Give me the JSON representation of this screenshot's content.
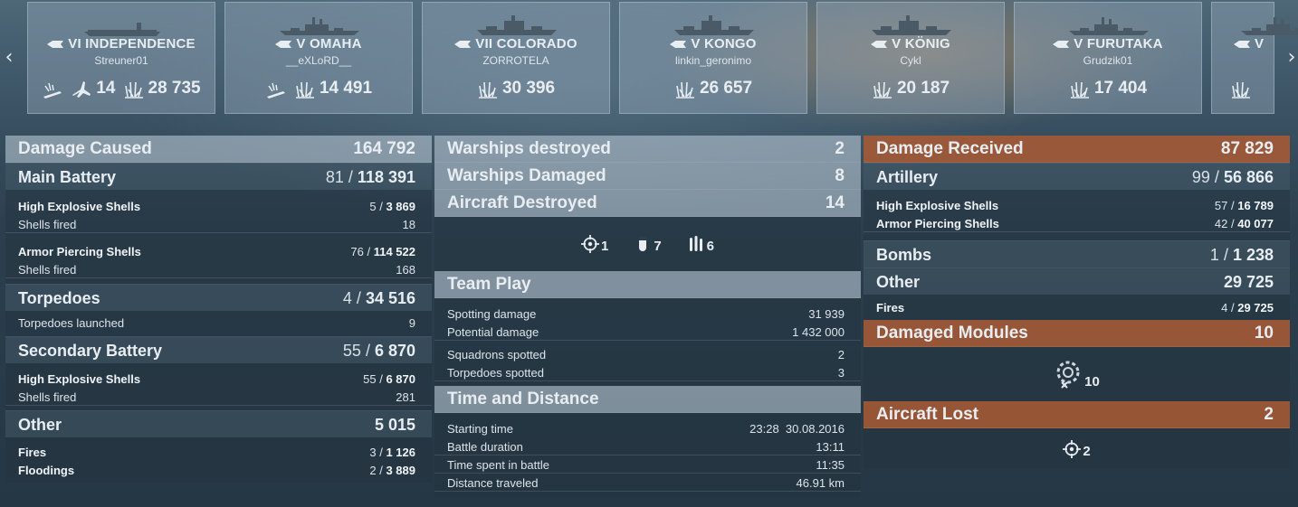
{
  "nav": {
    "prev": "‹",
    "next": "›"
  },
  "ships": [
    {
      "tier_name": "VI INDEPENDENCE",
      "type": "carrier",
      "player": "Streuner01",
      "planes": "14",
      "damage": "28 735"
    },
    {
      "tier_name": "V OMAHA",
      "type": "cruiser",
      "player": "__eXLoRD__",
      "damage": "14 491"
    },
    {
      "tier_name": "VII COLORADO",
      "type": "battleship",
      "player": "ZORROTELA",
      "damage": "30 396"
    },
    {
      "tier_name": "V KONGO",
      "type": "battleship",
      "player": "linkin_geronimo",
      "damage": "26 657"
    },
    {
      "tier_name": "V KÖNIG",
      "type": "battleship",
      "player": "Cykl",
      "damage": "20 187"
    },
    {
      "tier_name": "V FURUTAKA",
      "type": "cruiser",
      "player": "Grudzik01",
      "damage": "17 404"
    },
    {
      "tier_name": "V",
      "type": "cruiser",
      "player": "",
      "damage": ""
    }
  ],
  "damage_caused": {
    "title": "Damage Caused",
    "total": "164 792",
    "main_battery": {
      "label": "Main Battery",
      "hits": "81",
      "damage": "118 391"
    },
    "mb_he": {
      "label": "High Explosive Shells",
      "hits": "5",
      "damage": "3 869"
    },
    "mb_he_fired": {
      "label": "Shells fired",
      "value": "18"
    },
    "mb_ap": {
      "label": "Armor Piercing Shells",
      "hits": "76",
      "damage": "114 522"
    },
    "mb_ap_fired": {
      "label": "Shells fired",
      "value": "168"
    },
    "torpedoes": {
      "label": "Torpedoes",
      "hits": "4",
      "damage": "34 516"
    },
    "torp_launched": {
      "label": "Torpedoes launched",
      "value": "9"
    },
    "secondary": {
      "label": "Secondary Battery",
      "hits": "55",
      "damage": "6 870"
    },
    "sec_he": {
      "label": "High Explosive Shells",
      "hits": "55",
      "damage": "6 870"
    },
    "sec_fired": {
      "label": "Shells fired",
      "value": "281"
    },
    "other": {
      "label": "Other",
      "damage": "5 015"
    },
    "fires": {
      "label": "Fires",
      "hits": "3",
      "damage": "1 126"
    },
    "floodings": {
      "label": "Floodings",
      "hits": "2",
      "damage": "3 889"
    }
  },
  "middle": {
    "destroyed": {
      "label": "Warships destroyed",
      "value": "2"
    },
    "damaged": {
      "label": "Warships Damaged",
      "value": "8"
    },
    "aircraft": {
      "label": "Aircraft Destroyed",
      "value": "14"
    },
    "aircraft_icons": {
      "fighters": "1",
      "bombers": "7",
      "torpedo_bombers": "6"
    },
    "team_play": {
      "title": "Team Play",
      "spotting": {
        "label": "Spotting damage",
        "value": "31 939"
      },
      "potential": {
        "label": "Potential damage",
        "value": "1 432 000"
      },
      "squadrons": {
        "label": "Squadrons spotted",
        "value": "2"
      },
      "torps": {
        "label": "Torpedoes spotted",
        "value": "3"
      }
    },
    "time": {
      "title": "Time and Distance",
      "start": {
        "label": "Starting time",
        "value": "23:28  30.08.2016"
      },
      "duration": {
        "label": "Battle duration",
        "value": "13:11"
      },
      "spent": {
        "label": "Time spent in battle",
        "value": "11:35"
      },
      "distance": {
        "label": "Distance traveled",
        "value": "46.91 km"
      }
    }
  },
  "damage_received": {
    "title": "Damage Received",
    "total": "87 829",
    "artillery": {
      "label": "Artillery",
      "hits": "99",
      "damage": "56 866"
    },
    "art_he": {
      "label": "High Explosive Shells",
      "hits": "57",
      "damage": "16 789"
    },
    "art_ap": {
      "label": "Armor Piercing Shells",
      "hits": "42",
      "damage": "40 077"
    },
    "bombs": {
      "label": "Bombs",
      "hits": "1",
      "damage": "1 238"
    },
    "other": {
      "label": "Other",
      "damage": "29 725"
    },
    "fires": {
      "label": "Fires",
      "hits": "4",
      "damage": "29 725"
    },
    "modules": {
      "title": "Damaged Modules",
      "value": "10",
      "icon_count": "10"
    },
    "aircraft_lost": {
      "title": "Aircraft Lost",
      "value": "2",
      "icon_count": "2"
    }
  },
  "colors": {
    "accent_orange": "#a65a34",
    "header_grey": "#b4c3d0"
  }
}
